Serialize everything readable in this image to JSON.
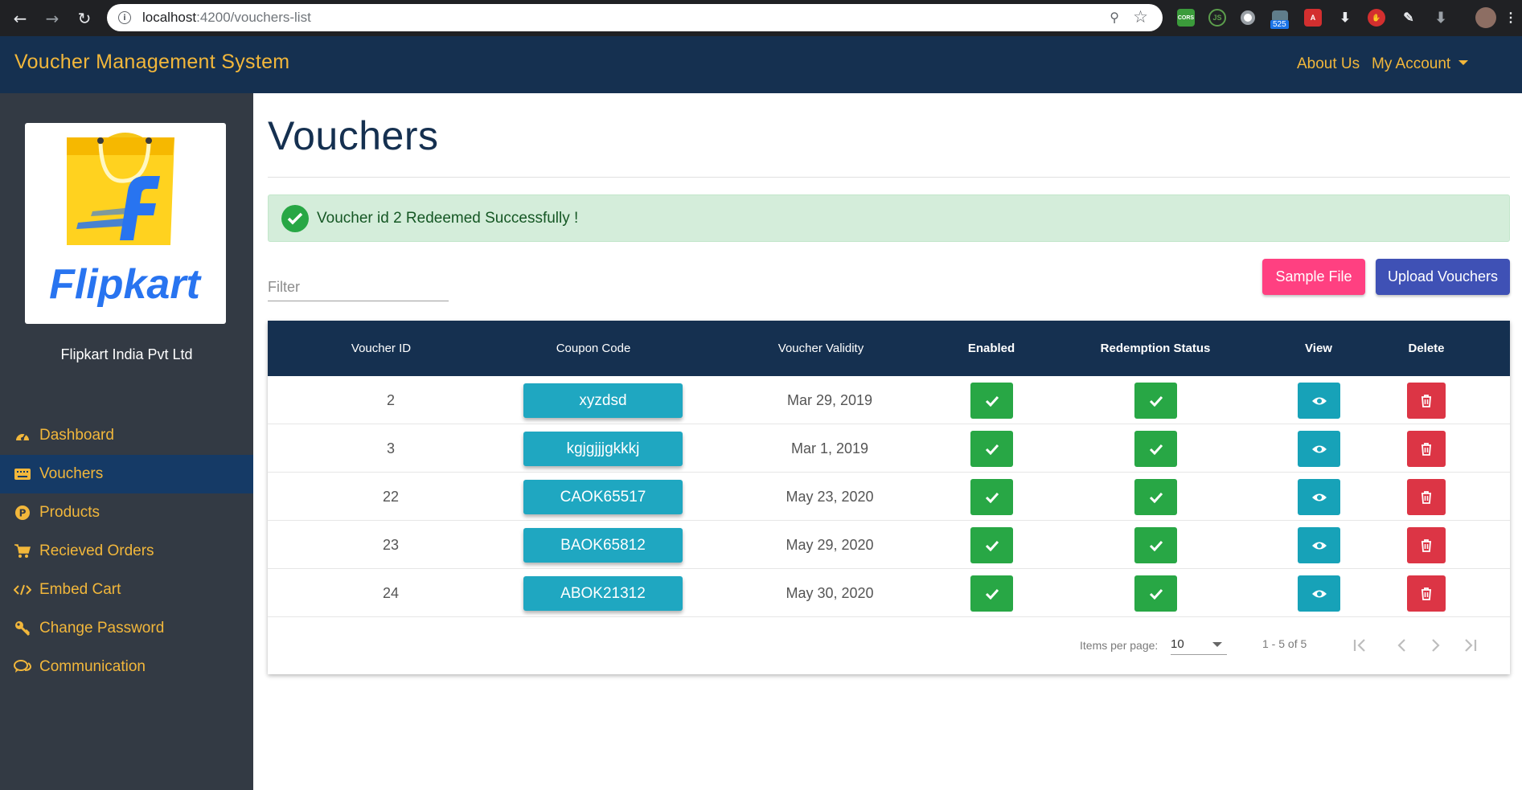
{
  "browser": {
    "url_host": "localhost",
    "url_path": ":4200/vouchers-list",
    "extension_badge": "525",
    "cors_ext": "CORS"
  },
  "navbar": {
    "brand": "Voucher Management System",
    "about": "About Us",
    "account": "My Account"
  },
  "sidebar": {
    "logo_text": "Flipkart",
    "company": "Flipkart India Pvt Ltd",
    "items": [
      {
        "label": "Dashboard",
        "icon": "dashboard-icon"
      },
      {
        "label": "Vouchers",
        "icon": "keyboard-icon"
      },
      {
        "label": "Products",
        "icon": "product-icon"
      },
      {
        "label": "Recieved Orders",
        "icon": "cart-icon"
      },
      {
        "label": "Embed Cart",
        "icon": "code-icon"
      },
      {
        "label": "Change Password",
        "icon": "key-icon"
      },
      {
        "label": "Communication",
        "icon": "chat-icon"
      }
    ],
    "active_index": 1
  },
  "main": {
    "title": "Vouchers",
    "alert": "Voucher id 2 Redeemed Successfully !",
    "filter_placeholder": "Filter",
    "sample_button": "Sample File",
    "upload_button": "Upload Vouchers"
  },
  "table": {
    "headers": [
      "Voucher ID",
      "Coupon Code",
      "Voucher Validity",
      "Enabled",
      "Redemption Status",
      "View",
      "Delete"
    ],
    "rows": [
      {
        "id": "2",
        "code": "xyzdsd",
        "validity": "Mar 29, 2019"
      },
      {
        "id": "3",
        "code": "kgjgjjjgkkkj",
        "validity": "Mar 1, 2019"
      },
      {
        "id": "22",
        "code": "CAOK65517",
        "validity": "May 23, 2020"
      },
      {
        "id": "23",
        "code": "BAOK65812",
        "validity": "May 29, 2020"
      },
      {
        "id": "24",
        "code": "ABOK21312",
        "validity": "May 30, 2020"
      }
    ]
  },
  "paginator": {
    "items_label": "Items per page:",
    "page_size": "10",
    "range": "1 - 5 of 5"
  },
  "colors": {
    "navbar": "#153050",
    "sidebar": "#333a44",
    "accent": "#f2b73b",
    "green": "#28a745",
    "teal": "#17a2b8",
    "red": "#dc3545",
    "pink": "#ff4081",
    "indigo": "#3f51b5"
  }
}
